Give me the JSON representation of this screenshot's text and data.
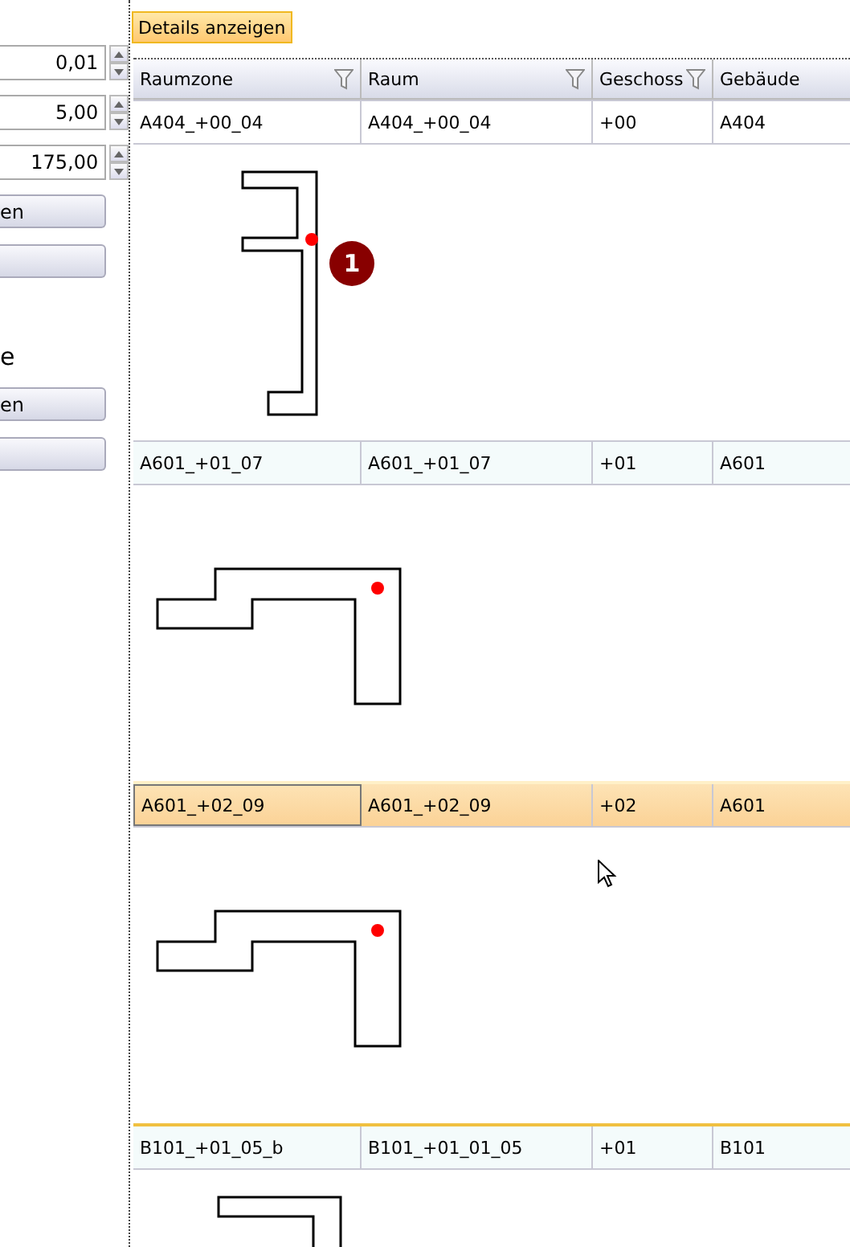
{
  "left_panel": {
    "fields": [
      {
        "value": "0,01"
      },
      {
        "value": "5,00"
      },
      {
        "value": "175,00"
      }
    ],
    "buttons_top": [
      {
        "kind": "text",
        "label": "en"
      },
      {
        "kind": "blank"
      }
    ],
    "label": "e",
    "buttons_bottom": [
      {
        "kind": "text",
        "label": "en"
      },
      {
        "kind": "blank"
      }
    ]
  },
  "details_button": {
    "label": "Details anzeigen"
  },
  "table": {
    "columns": [
      {
        "label": "Raumzone",
        "filter": true
      },
      {
        "label": "Raum",
        "filter": true
      },
      {
        "label": "Geschoss",
        "filter": true
      },
      {
        "label": "Gebäude",
        "filter": false
      }
    ],
    "rows": [
      {
        "cells": [
          "A404_+00_04",
          "A404_+00_04",
          "+00",
          "A404"
        ],
        "selected": false,
        "detail": {
          "badge": "1"
        }
      },
      {
        "cells": [
          "A601_+01_07",
          "A601_+01_07",
          "+01",
          "A601"
        ],
        "selected": false
      },
      {
        "cells": [
          "A601_+02_09",
          "A601_+02_09",
          "+02",
          "A601"
        ],
        "selected": true
      },
      {
        "cells": [
          "B101_+01_05_b",
          "B101_+01_01_05",
          "+01",
          "B101"
        ],
        "selected": false
      }
    ]
  }
}
